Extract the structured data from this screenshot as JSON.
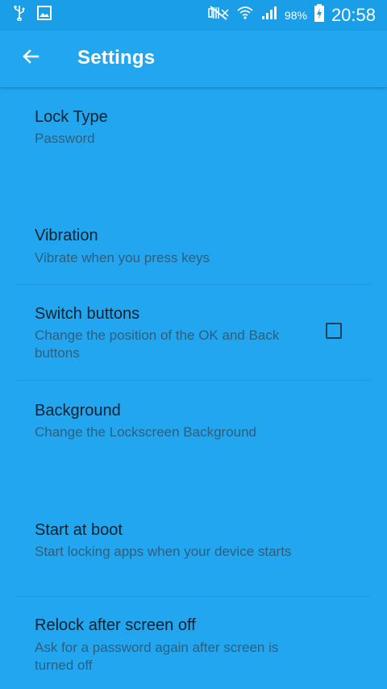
{
  "status_bar": {
    "icons_left": [
      "usb-icon",
      "image-icon"
    ],
    "icons_right": [
      "mute-icon",
      "wifi-icon",
      "signal-icon",
      "battery-charging-icon"
    ],
    "battery_percent": "98%",
    "time": "20:58"
  },
  "toolbar": {
    "back_icon": "arrow-left-icon",
    "title": "Settings"
  },
  "settings": [
    {
      "title": "Lock Type",
      "summary": "Password"
    },
    {
      "title": "Vibration",
      "summary": "Vibrate when you press keys"
    },
    {
      "title": "Switch buttons",
      "summary": "Change the position of the OK and Back buttons",
      "checkbox": false
    },
    {
      "title": "Background",
      "summary": "Change the Lockscreen Background"
    },
    {
      "title": "Start at boot",
      "summary": "Start locking apps when your device starts"
    },
    {
      "title": "Relock after screen off",
      "summary": "Ask for a password again after screen is turned off"
    }
  ],
  "colors": {
    "background": "#22a6f0",
    "status_bar": "#1a9ee8",
    "title_text": "#0f2230",
    "summary_text": "#2d5f7e"
  }
}
